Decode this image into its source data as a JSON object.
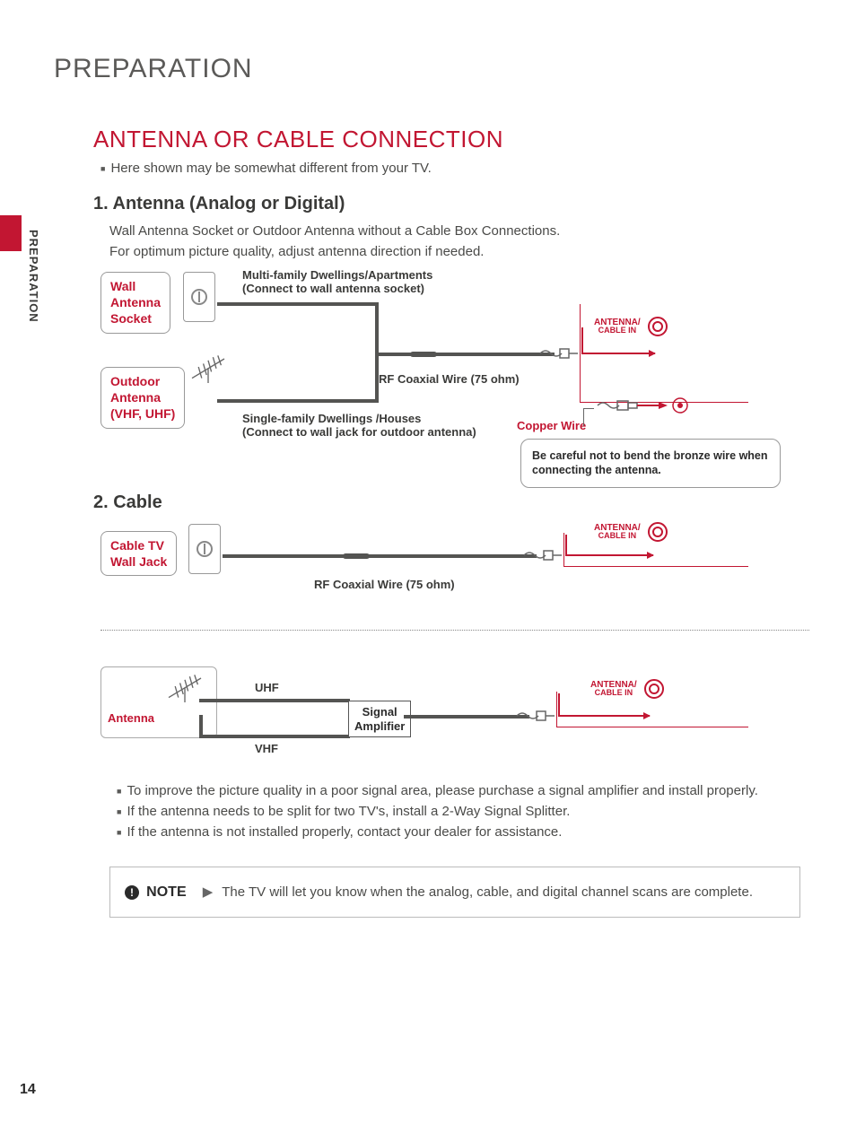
{
  "page_title": "PREPARATION",
  "sidebar_label": "PREPARATION",
  "page_number": "14",
  "section_title": "ANTENNA OR CABLE CONNECTION",
  "intro_bullet": "Here shown may be somewhat different from your TV.",
  "sub1": {
    "title": "1. Antenna (Analog or Digital)",
    "p1": "Wall Antenna Socket or Outdoor Antenna without a Cable Box Connections.",
    "p2": "For optimum picture quality, adjust antenna direction if needed."
  },
  "d1": {
    "wall_antenna_socket": "Wall\nAntenna\nSocket",
    "outdoor_antenna": "Outdoor\nAntenna\n(VHF, UHF)",
    "multi_family": "Multi-family Dwellings/Apartments\n(Connect to wall antenna socket)",
    "single_family": "Single-family Dwellings /Houses\n(Connect to wall jack for outdoor antenna)",
    "rf_wire": "RF Coaxial Wire (75 ohm)",
    "antenna_in_a": "ANTENNA/",
    "antenna_in_b": "CABLE IN",
    "copper_wire": "Copper Wire",
    "warn": "Be careful not to bend the bronze wire when connecting the antenna."
  },
  "sub2": {
    "title": "2. Cable"
  },
  "d2": {
    "cable_tv_jack": "Cable TV\nWall Jack",
    "rf_wire": "RF Coaxial Wire (75 ohm)",
    "antenna_in_a": "ANTENNA/",
    "antenna_in_b": "CABLE IN"
  },
  "d3": {
    "antenna": "Antenna",
    "uhf": "UHF",
    "vhf": "VHF",
    "signal_amp": "Signal\nAmplifier",
    "antenna_in_a": "ANTENNA/",
    "antenna_in_b": "CABLE IN"
  },
  "tips": {
    "b1": "To improve the picture quality in a poor signal area, please purchase a signal amplifier and install properly.",
    "b2": "If the antenna needs to be split for two TV's, install a 2-Way Signal Splitter.",
    "b3": "If the antenna is not installed properly, contact your dealer for assistance."
  },
  "note": {
    "label": "NOTE",
    "text": "The TV will let you know when the analog, cable, and digital channel scans are complete."
  }
}
